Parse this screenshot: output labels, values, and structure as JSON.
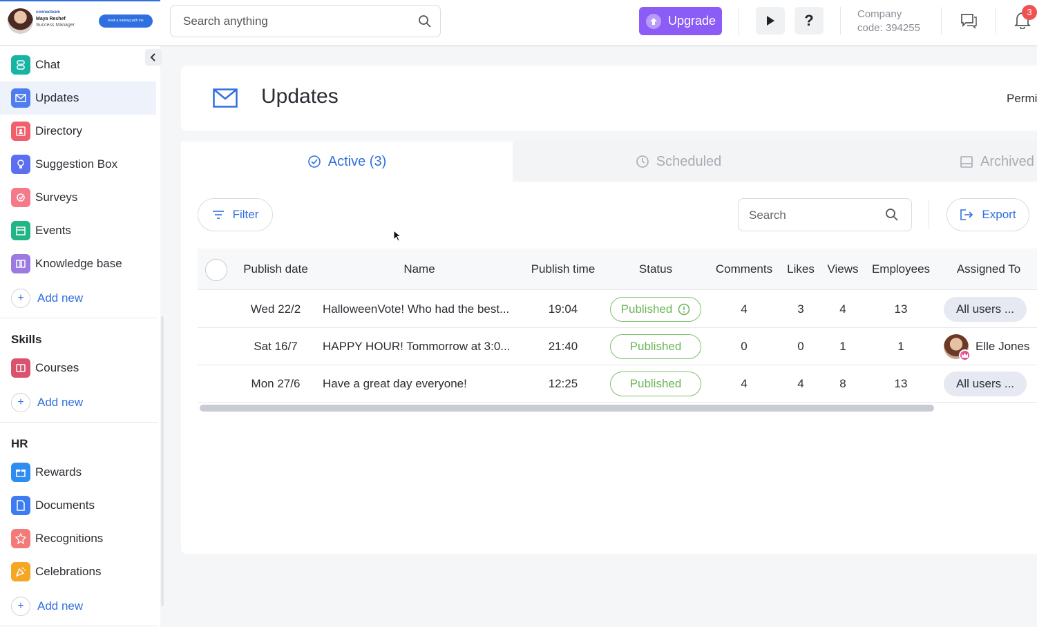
{
  "brand": {
    "org": "connecteam",
    "person_name": "Maya Reshef",
    "person_role": "Success Manager",
    "cta": "book a training with me"
  },
  "topbar": {
    "search_placeholder": "Search anything",
    "upgrade_label": "Upgrade",
    "company_line1": "Company",
    "company_line2": "code: 394255",
    "notification_count": "3"
  },
  "sidebar": {
    "items": [
      {
        "label": "Chat",
        "color": "#17b3a3"
      },
      {
        "label": "Updates",
        "color": "#4f7df0"
      },
      {
        "label": "Directory",
        "color": "#ef5f6c"
      },
      {
        "label": "Suggestion Box",
        "color": "#5b6ff0"
      },
      {
        "label": "Surveys",
        "color": "#f47a8b"
      },
      {
        "label": "Events",
        "color": "#20b486"
      },
      {
        "label": "Knowledge base",
        "color": "#9b7be0"
      }
    ],
    "add_new_label": "Add new",
    "skills_title": "Skills",
    "skills_items": [
      {
        "label": "Courses",
        "color": "#d9536e"
      }
    ],
    "hr_title": "HR",
    "hr_items": [
      {
        "label": "Rewards",
        "color": "#2e8df0"
      },
      {
        "label": "Documents",
        "color": "#3c7bf0"
      },
      {
        "label": "Recognitions",
        "color": "#f47a7a"
      },
      {
        "label": "Celebrations",
        "color": "#f5a623"
      }
    ]
  },
  "page": {
    "title": "Updates",
    "permissions_partial": "Permi"
  },
  "tabs": [
    {
      "label": "Active (3)",
      "active": true
    },
    {
      "label": "Scheduled",
      "active": false
    },
    {
      "label": "Archived",
      "active": false
    }
  ],
  "toolbar": {
    "filter_label": "Filter",
    "search_placeholder": "Search",
    "export_label": "Export"
  },
  "table": {
    "columns": [
      "Publish date",
      "Name",
      "Publish time",
      "Status",
      "Comments",
      "Likes",
      "Views",
      "Employees",
      "Assigned To"
    ],
    "rows": [
      {
        "date": "Wed 22/2",
        "name": "HalloweenVote! Who had the best...",
        "time": "19:04",
        "status": "Published",
        "status_alert": true,
        "comments": "4",
        "likes": "3",
        "views": "4",
        "employees": "13",
        "assigned": "All users ...",
        "assigned_type": "group"
      },
      {
        "date": "Sat 16/7",
        "name": "HAPPY HOUR! Tommorrow at 3:0...",
        "time": "21:40",
        "status": "Published",
        "status_alert": false,
        "comments": "0",
        "likes": "0",
        "views": "1",
        "employees": "1",
        "assigned": "Elle Jones",
        "assigned_type": "user"
      },
      {
        "date": "Mon 27/6",
        "name": "Have a great day everyone!",
        "time": "12:25",
        "status": "Published",
        "status_alert": false,
        "comments": "4",
        "likes": "4",
        "views": "8",
        "employees": "13",
        "assigned": "All users ...",
        "assigned_type": "group"
      }
    ]
  },
  "colors": {
    "accent": "#2f6fe0",
    "upgrade": "#8b5cf6",
    "published": "#6bb556",
    "badge": "#f05252"
  }
}
